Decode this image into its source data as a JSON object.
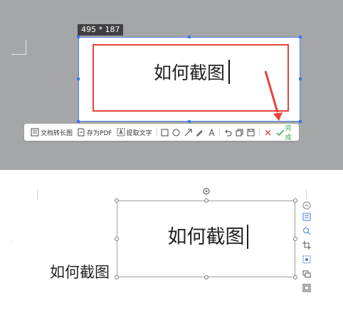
{
  "screenshot_tool": {
    "size_badge": "495 * 187",
    "caption_text": "如何截图",
    "toolbar": {
      "long_image_label": "文档转长图",
      "save_pdf_label": "存为PDF",
      "extract_text_label": "提取文字",
      "shape_tools": [
        "rectangle-icon",
        "ellipse-icon",
        "arrow-icon",
        "pen-icon",
        "text-icon"
      ],
      "action_tools": [
        "undo-icon",
        "copy-icon",
        "save-icon"
      ],
      "cancel_icon": "close-icon",
      "done_label": "完成"
    },
    "colors": {
      "annotation_red": "#e8413a",
      "selection_blue": "#3a78f0",
      "done_green": "#2aa14d"
    }
  },
  "document": {
    "pasted_image_caption": "如何截图",
    "body_text": "如何截图",
    "side_tools": [
      "layout-options-icon",
      "zoom-icon",
      "crop-icon",
      "image-adjust-icon",
      "replace-image-icon",
      "more-options-icon"
    ],
    "collapse_icon": "minus-icon"
  }
}
